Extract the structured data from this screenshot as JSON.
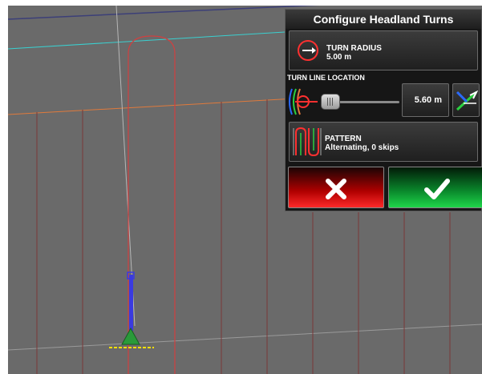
{
  "panel": {
    "title": "Configure Headland Turns",
    "turn_radius": {
      "label": "TURN RADIUS",
      "value": "5.00 m",
      "icon": "turn-radius-icon"
    },
    "turn_line_location": {
      "label": "TURN LINE LOCATION",
      "value": "5.60 m",
      "icon": "turn-line-icon"
    },
    "pattern": {
      "label": "PATTERN",
      "value": "Alternating, 0 skips",
      "icon": "pattern-icon"
    },
    "cancel_icon": "x-icon",
    "confirm_icon": "checkmark-icon"
  },
  "colors": {
    "field_background": "#6a6a6a",
    "guidance_line": "#d04040",
    "boundary_orange": "#e07a3c",
    "boundary_cyan": "#3ad0d0",
    "cancel": "#d01010",
    "confirm": "#10b030"
  }
}
